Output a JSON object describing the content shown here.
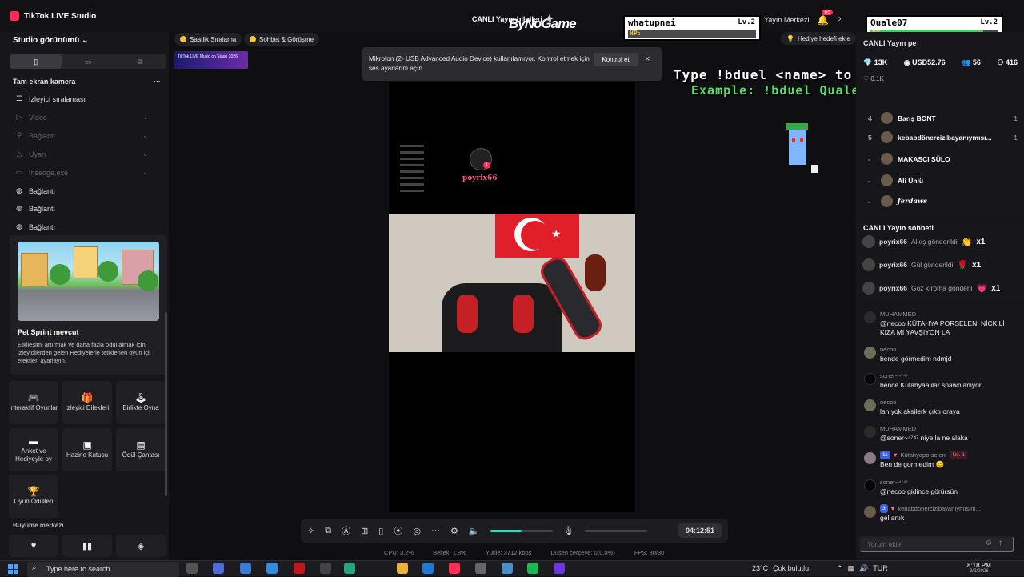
{
  "titlebar": {
    "app_title": "TikTok LIVE Studio",
    "live_title": "CANLI Yayın bilgileri",
    "brand": "ByNoGame",
    "broadcast_center": "Yayın Merkezi",
    "notif_count": "65"
  },
  "sidebar": {
    "studio_view": "Studio görünümü",
    "camera_header": "Tam ekran kamera",
    "sources": [
      {
        "label": "İzleyici sıralaması",
        "icon": "list-icon",
        "dim": false
      },
      {
        "label": "Video",
        "icon": "play-icon",
        "dim": true
      },
      {
        "label": "Bağlantı",
        "icon": "link-icon",
        "dim": true
      },
      {
        "label": "Uyarı",
        "icon": "alert-icon",
        "dim": true
      },
      {
        "label": "msedge.exe",
        "icon": "window-icon",
        "dim": true
      },
      {
        "label": "Bağlantı",
        "icon": "globe-icon",
        "dim": false
      },
      {
        "label": "Bağlantı",
        "icon": "globe-icon",
        "dim": false
      },
      {
        "label": "Bağlantı",
        "icon": "globe-icon",
        "dim": false
      }
    ],
    "pet_card": {
      "title": "Pet Sprint mevcut",
      "desc": "Etkileşimi artırmak ve daha fazla ödül almak için izleyicilerden gelen Hediyelerle tetiklenen oyun içi efektleri ayarlayın."
    },
    "tiles": [
      {
        "label": "İnteraktif Oyunlar",
        "icon": "gamepad-icon"
      },
      {
        "label": "İzleyici Dilekleri",
        "icon": "gift-icon"
      },
      {
        "label": "Birlikte Oyna",
        "icon": "joystick-icon"
      },
      {
        "label": "Anket ve Hediyeyle oy",
        "icon": "poll-icon"
      },
      {
        "label": "Hazine Kutusu",
        "icon": "chest-icon"
      },
      {
        "label": "Ödül Çantası",
        "icon": "bag-icon"
      },
      {
        "label": "Oyun Ödülleri",
        "icon": "trophy-icon"
      }
    ],
    "growth_title": "Büyüme merkezi"
  },
  "chips": [
    {
      "label": "Saatlik Sıralama"
    },
    {
      "label": "Sohbet & Görüşme"
    }
  ],
  "banner_text": "TikTok LIVE Music on Stage 2026",
  "toast": {
    "text": "Mikrofon (2- USB Advanced Audio Device) kullanılamıyor. Kontrol etmek için ses ayarlarını açın.",
    "button": "Kontrol et"
  },
  "stream": {
    "viewer_name": "poyrix66",
    "viewer_badge": "1"
  },
  "overlay": {
    "player1": {
      "name": "whatupnei",
      "level": "Lv.2",
      "hp_label": "HP:",
      "hp": 0.0
    },
    "player2": {
      "name": "Quale07",
      "level": "Lv.2",
      "hp_label": "HP:",
      "hp": 0.88
    },
    "type_to_play": "Type !bduel <name> to play",
    "example": "Example: !bduel Quale07"
  },
  "goal_button": "Hediye hedefi ekle",
  "controls": {
    "volume": 0.5,
    "timer": "04:12:51"
  },
  "stats": [
    "CPU: 3.2%",
    "Bellek: 1.8%",
    "Yükle: 3712 kbps",
    "Düşen çerçeve: 0(0.0%)",
    "FPS: 30/30"
  ],
  "right_panel": {
    "header": "CANLI Yayın pe",
    "diamonds": "13K",
    "usd": "USD52.76",
    "viewers": "56",
    "followers": "416",
    "likes": "0.1K",
    "ranking": [
      {
        "num": "4",
        "name": "Barış BONT",
        "score": "1"
      },
      {
        "num": "5",
        "name": "kebabdönercizibayanıymısı...",
        "score": "1"
      },
      {
        "num": "-",
        "name": "MAKASCI SÜLO",
        "score": ""
      },
      {
        "num": "-",
        "name": "Ali Ünlü",
        "score": ""
      },
      {
        "num": "-",
        "name": "ƒerdaws",
        "score": ""
      }
    ],
    "chat_title": "CANLI Yayın sohbeti",
    "gifts": [
      {
        "user": "poyrix66",
        "action": "Alkış gönderildi",
        "count": "x1",
        "emoji": "👏"
      },
      {
        "user": "poyrix66",
        "action": "Gül gönderildi",
        "count": "x1",
        "emoji": "🌹"
      },
      {
        "user": "poyrix66",
        "action": "Göz kırpma gönderil",
        "count": "x1",
        "emoji": "💗"
      }
    ],
    "messages": [
      {
        "user": "MUHAMMED",
        "text": "@necoo KÜTAHYA PORSELENİ NİCK Lİ KIZA MI YAVŞIYON LA"
      },
      {
        "user": "necoo",
        "text": "bende görmedim ndmjd"
      },
      {
        "user": "soner~⁴⁷⁴⁷",
        "text": "bence Kütahyaalilar spawnlaniyor"
      },
      {
        "user": "necoo",
        "text": "lan yok aksilerk çıktı oraya"
      },
      {
        "user": "MUHAMMED",
        "text": "@soner~⁴⁷⁴⁷ niye la ne alaka"
      },
      {
        "user": "Kütahyaporseleni",
        "level": "11",
        "no1": "No. 1",
        "text": "Ben de gormedim 😊"
      },
      {
        "user": "soner~⁴⁷⁴⁷",
        "text": "@necoo gidince görürsün"
      },
      {
        "user": "kebabdönercizibayanıymısım...",
        "level": "3",
        "text": "gel artık"
      }
    ],
    "comment_placeholder": "Yorum ekle"
  },
  "taskbar": {
    "search_placeholder": "Type here to search",
    "weather": "23°C",
    "weather_desc": "Çok bulutlu",
    "lang": "TUR",
    "time": "8:18 PM",
    "date": "9/2/2026"
  }
}
